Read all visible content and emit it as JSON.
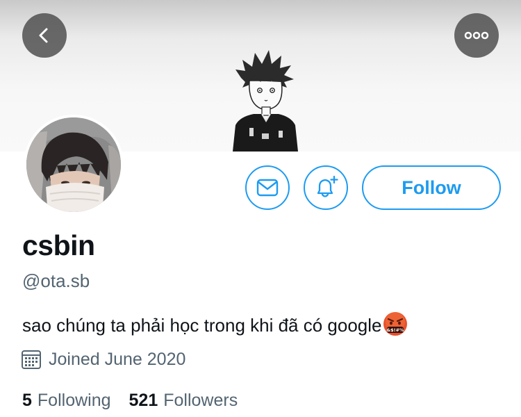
{
  "profile": {
    "name": "csbin",
    "handle": "@ota.sb",
    "bio": "sao chúng ta phải học trong khi đã có google",
    "bio_emoji": "face-with-symbols-on-mouth",
    "joined": "Joined June 2020"
  },
  "actions": {
    "follow_label": "Follow"
  },
  "stats": {
    "following_count": "5",
    "following_label": "Following",
    "followers_count": "521",
    "followers_label": "Followers"
  },
  "icons": {
    "back": "chevron-left-icon",
    "more": "more-horizontal-icon",
    "message": "envelope-icon",
    "notify": "bell-plus-icon",
    "calendar": "calendar-icon"
  },
  "colors": {
    "accent": "#1d9bf0",
    "text_primary": "#0f1419",
    "text_secondary": "#536471"
  }
}
